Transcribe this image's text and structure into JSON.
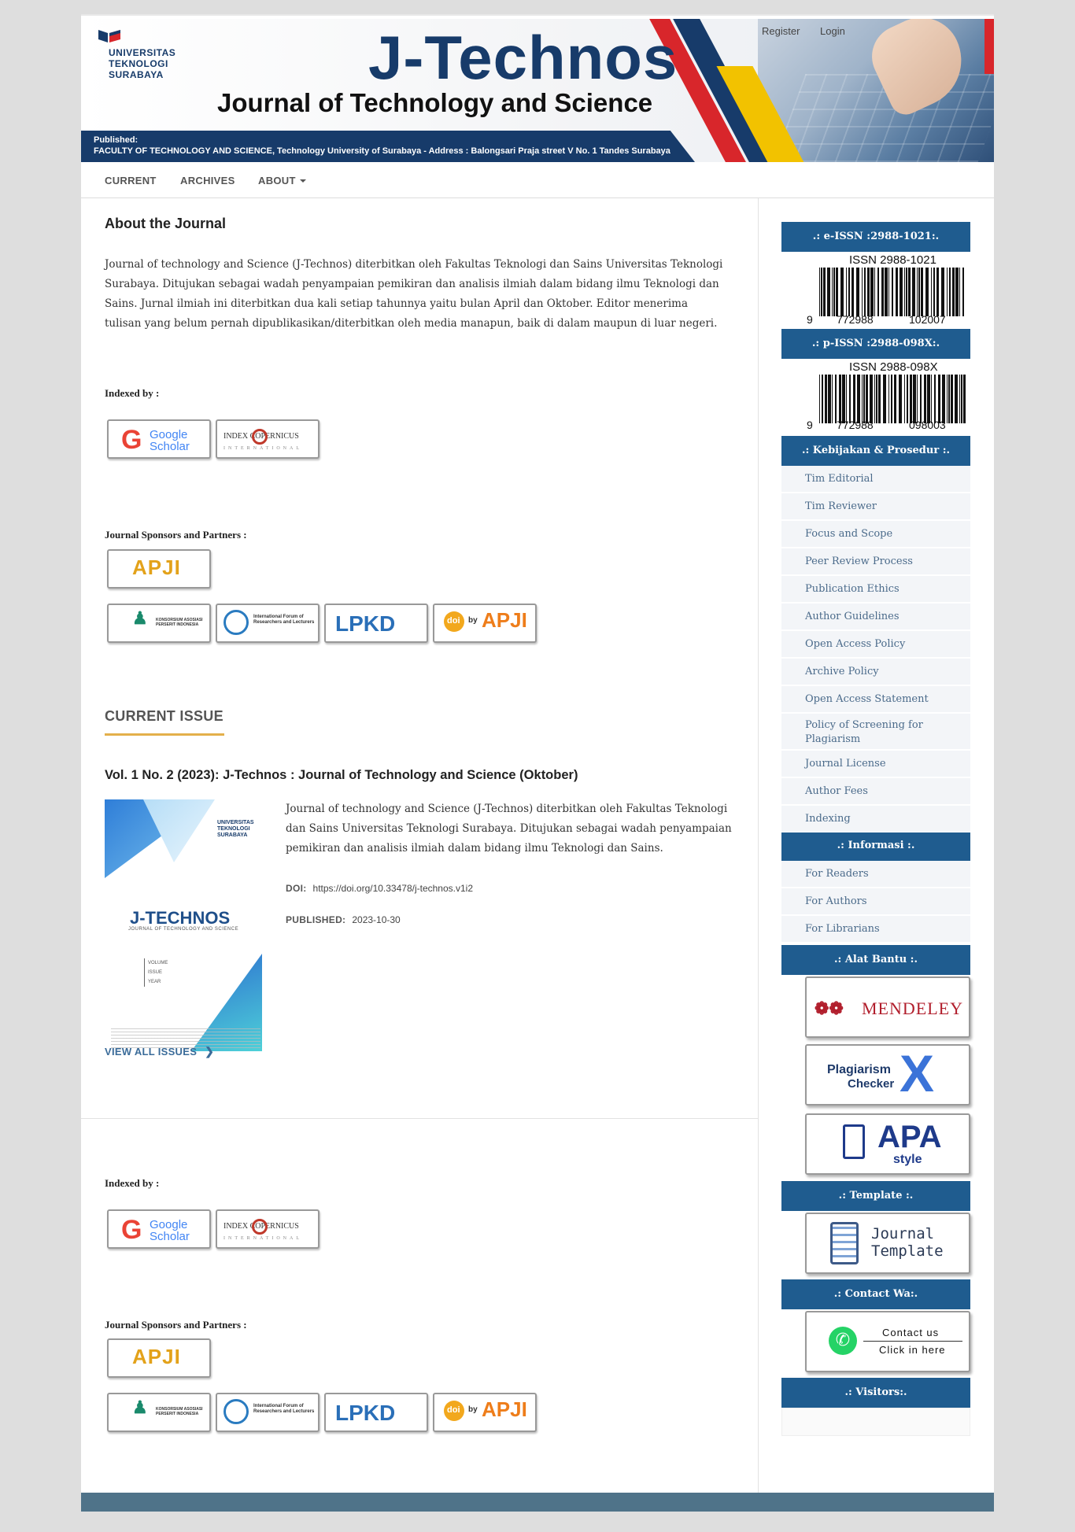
{
  "header": {
    "university": "UNIVERSITAS\nTEKNOLOGI\nSURABAYA",
    "site_title": "J-Technos",
    "site_subtitle": "Journal of Technology and Science",
    "published_label": "Published:",
    "published_line": "FACULTY OF TECHNOLOGY AND SCIENCE, Technology University of Surabaya  -  Address : Balongsari Praja street V No. 1 Tandes Surabaya",
    "register": "Register",
    "login": "Login"
  },
  "nav": {
    "current": "CURRENT",
    "archives": "ARCHIVES",
    "about": "ABOUT"
  },
  "about": {
    "heading": "About the Journal",
    "text": "Journal of technology and Science (J-Technos) diterbitkan oleh Fakultas Teknologi dan Sains Universitas Teknologi Surabaya. Ditujukan sebagai wadah penyampaian pemikiran dan analisis ilmiah dalam bidang ilmu Teknologi dan Sains. Jurnal ilmiah ini diterbitkan dua kali setiap tahunnya yaitu bulan April dan Oktober. Editor menerima tulisan yang belum pernah dipublikasikan/diterbitkan oleh media manapun, baik di dalam maupun di luar negeri.",
    "indexed_by": "Indexed by :",
    "sponsors": "Journal Sponsors and Partners :"
  },
  "badges": {
    "google": "Google",
    "scholar": "Scholar",
    "index_copernicus": "INDEX   COPERNICUS",
    "international": "INTERNATIONAL",
    "apji": "APJI",
    "kaspi": "KONSORSIUM ASOSIASI PERSERIT INDONESIA",
    "ifrel": "International Forum of Researchers and Lecturers",
    "lpkd": "LPKD",
    "doi_apji": "APJI",
    "doi_by": "by",
    "doi": "doi"
  },
  "current_issue": {
    "heading": "CURRENT ISSUE",
    "title": "Vol. 1 No. 2 (2023): J-Technos : Journal of Technology and Science (Oktober)",
    "description": "Journal of technology and Science (J-Technos) diterbitkan oleh Fakultas Teknologi dan Sains Universitas Teknologi Surabaya. Ditujukan sebagai wadah penyampaian pemikiran dan analisis ilmiah dalam bidang ilmu Teknologi dan Sains.",
    "doi_label": "DOI:",
    "doi_value": "https://doi.org/10.33478/j-technos.v1i2",
    "published_label": "PUBLISHED:",
    "published_value": "2023-10-30",
    "view_all": "VIEW ALL ISSUES",
    "cover_title": "J-TECHNOS",
    "cover_sub": "JOURNAL OF TECHNOLOGY AND SCIENCE",
    "cover_uni": "UNIVERSITAS\nTEKNOLOGI\nSURABAYA",
    "cover_vol": "VOLUME\nISSUE\nYEAR"
  },
  "sidebar": {
    "eissn_head": ".: e-ISSN :2988-1021:.",
    "eissn_text": "ISSN 2988-1021",
    "eissn_left": "9",
    "eissn_mid": "772988",
    "eissn_right": "102007",
    "pissn_head": ".: p-ISSN :2988-098X:.",
    "pissn_text": "ISSN 2988-098X",
    "pissn_left": "9",
    "pissn_mid": "772988",
    "pissn_right": "098003",
    "policy_head": ".: Kebijakan & Prosedur :.",
    "policy_items": [
      "Tim Editorial",
      "Tim Reviewer",
      "Focus and Scope",
      "Peer Review Process",
      "Publication Ethics",
      "Author Guidelines",
      "Open Access Policy",
      "Archive Policy",
      "Open Access Statement",
      "Policy of Screening for Plagiarism",
      "Journal License",
      "Author Fees",
      "Indexing"
    ],
    "info_head": ".: Informasi :.",
    "info_items": [
      "For Readers",
      "For Authors",
      "For Librarians"
    ],
    "tools_head": ".: Alat Bantu :.",
    "mendeley": "MENDELEY",
    "plagiarism": "Plagiarism",
    "checker": "Checker",
    "apa": "APA",
    "apa_style": "style",
    "template_head": ".: Template :.",
    "journal": "Journal",
    "template": "Template",
    "contact_head": ".: Contact Wa:.",
    "contact_us": "Contact us",
    "click_here": "Click in here",
    "visitors_head": ".: Visitors:."
  },
  "colors": {
    "brand_navy": "#173b6a",
    "sidebar_head": "#1f5c8f",
    "accent_gold": "#e3b04b",
    "footer": "#4f7389"
  }
}
